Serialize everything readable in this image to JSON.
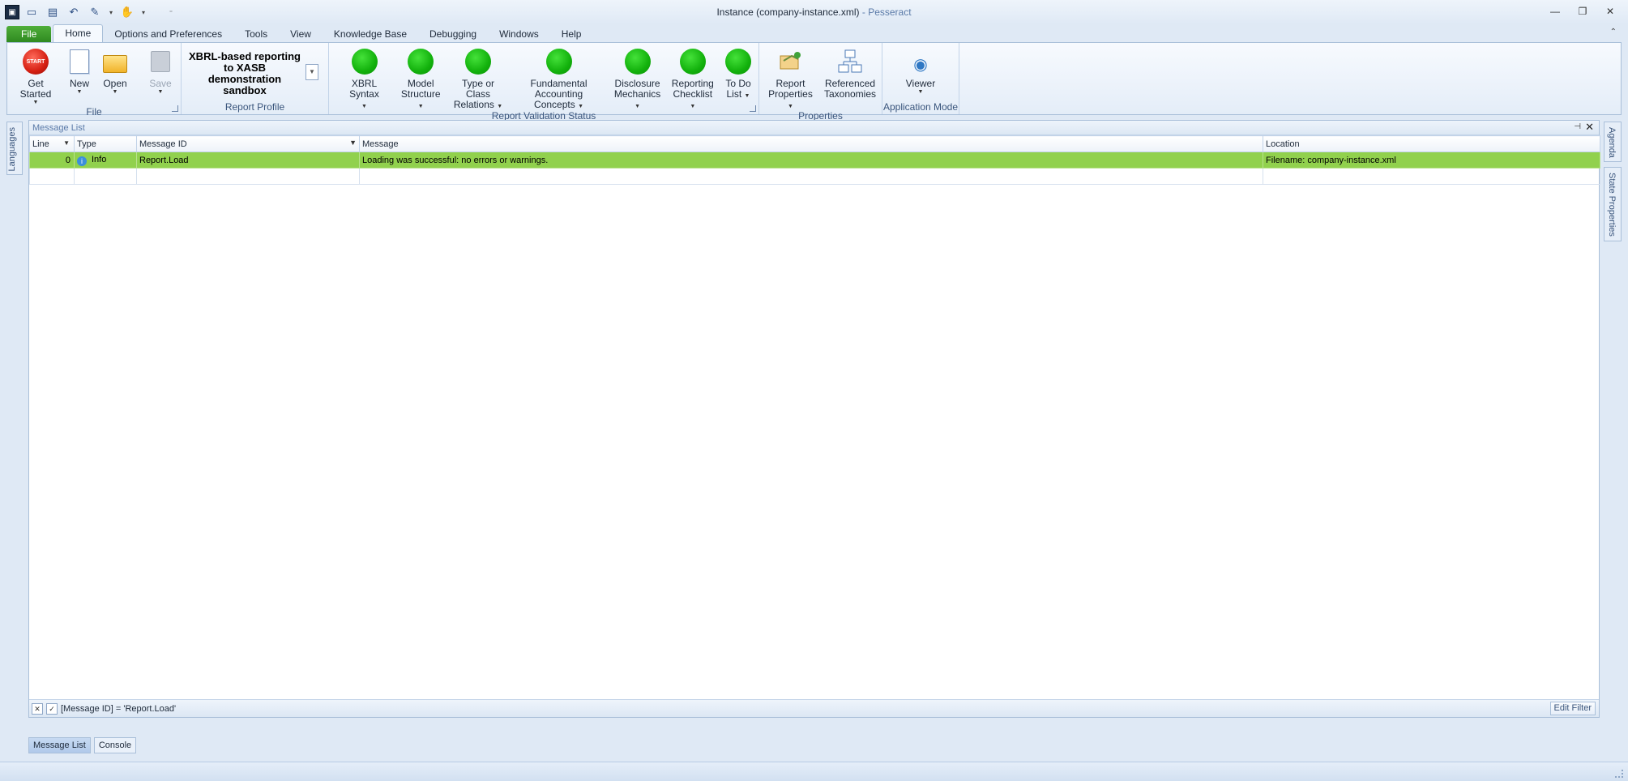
{
  "window": {
    "title": "Instance (company-instance.xml)",
    "app_name": "Pesseract",
    "separator": " - "
  },
  "menu_tabs": [
    "File",
    "Home",
    "Options and Preferences",
    "Tools",
    "View",
    "Knowledge Base",
    "Debugging",
    "Windows",
    "Help"
  ],
  "ribbon": {
    "file_group": {
      "label": "File",
      "get_started": "Get Started",
      "start_icon_text": "START",
      "new": "New",
      "open": "Open",
      "save": "Save"
    },
    "report_profile": {
      "label": "Report Profile",
      "value": "XBRL-based reporting to XASB demonstration sandbox"
    },
    "validation": {
      "label": "Report Validation Status",
      "items": [
        {
          "line1": "XBRL Syntax",
          "line2": ""
        },
        {
          "line1": "Model",
          "line2": "Structure"
        },
        {
          "line1": "Type or Class",
          "line2": "Relations"
        },
        {
          "line1": "Fundamental",
          "line2": "Accounting Concepts"
        },
        {
          "line1": "Disclosure",
          "line2": "Mechanics"
        },
        {
          "line1": "Reporting",
          "line2": "Checklist"
        },
        {
          "line1": "To Do",
          "line2": "List"
        }
      ]
    },
    "properties": {
      "label": "Properties",
      "report_properties": {
        "line1": "Report",
        "line2": "Properties"
      },
      "referenced_taxonomies": {
        "line1": "Referenced",
        "line2": "Taxonomies"
      }
    },
    "application_mode": {
      "label": "Application Mode",
      "viewer": "Viewer"
    }
  },
  "side_panels": {
    "left": "Languages",
    "right_top": "Agenda",
    "right_bottom": "State Properties"
  },
  "message_list": {
    "title": "Message List",
    "columns": [
      "Line",
      "Type",
      "Message ID",
      "Message",
      "Location"
    ],
    "rows": [
      {
        "line": "0",
        "type": "Info",
        "message_id": "Report.Load",
        "message": "Loading was successful: no errors or warnings.",
        "location": "Filename: company-instance.xml"
      }
    ],
    "filter_text": "[Message ID] = 'Report.Load'",
    "edit_filter": "Edit Filter"
  },
  "bottom_tabs": [
    "Message List",
    "Console"
  ],
  "colors": {
    "selected_row": "#91d14d",
    "status_ok": "#12b10c",
    "file_tab": "#3a9a2a"
  }
}
